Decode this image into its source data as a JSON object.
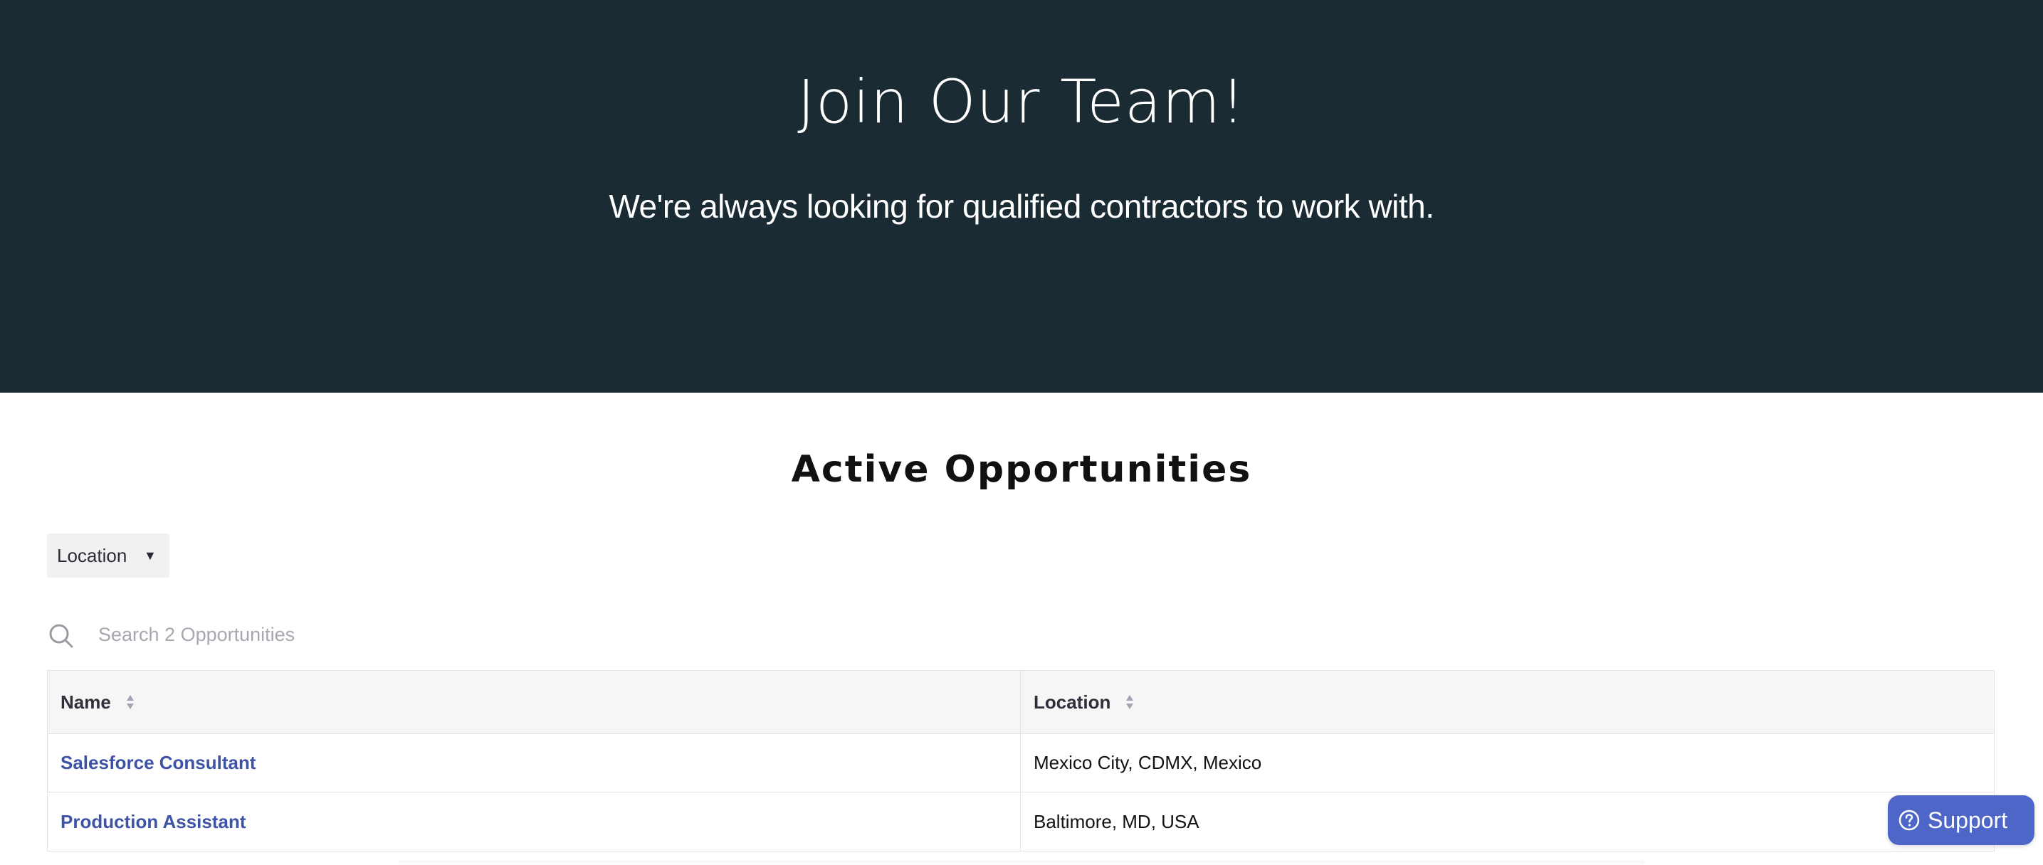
{
  "hero": {
    "title": "Join Our Team!",
    "subtitle": "We're always looking for qualified contractors to work with.",
    "background_color": "#1b2b33"
  },
  "section": {
    "title": "Active Opportunities"
  },
  "filters": {
    "location_label": "Location",
    "location_icon": "caret-down-icon"
  },
  "search": {
    "placeholder": "Search 2 Opportunities",
    "icon": "search-icon"
  },
  "table": {
    "columns": [
      {
        "label": "Name",
        "sort_icon": "sort-icon"
      },
      {
        "label": "Location",
        "sort_icon": "sort-icon"
      }
    ],
    "rows": [
      {
        "name": "Salesforce Consultant",
        "location": "Mexico City, CDMX, Mexico"
      },
      {
        "name": "Production Assistant",
        "location": "Baltimore, MD, USA"
      }
    ],
    "link_color": "#3e53a6"
  },
  "support": {
    "label": "Support",
    "icon": "help-circle-icon",
    "color": "#4e66c8"
  }
}
